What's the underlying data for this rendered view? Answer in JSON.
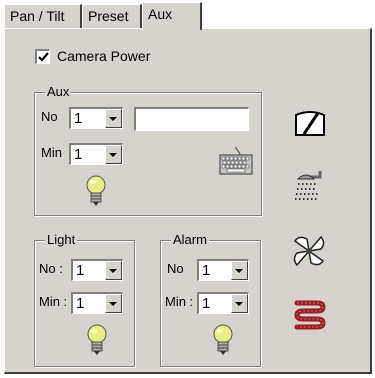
{
  "tabs": [
    {
      "label": "Pan / Tilt"
    },
    {
      "label": "Preset"
    },
    {
      "label": "Aux",
      "active": true
    }
  ],
  "camera_power": {
    "label": "Camera Power",
    "checked": true
  },
  "aux_group": {
    "legend": "Aux",
    "no_label": "No",
    "no_value": "1",
    "min_label": "Min",
    "min_value": "1",
    "text_value": ""
  },
  "light_group": {
    "legend": "Light",
    "no_label": "No :",
    "no_value": "1",
    "min_label": "Min :",
    "min_value": "1"
  },
  "alarm_group": {
    "legend": "Alarm",
    "no_label": "No",
    "no_value": "1",
    "min_label": "Min :",
    "min_value": "1"
  },
  "icons": [
    "wiper-icon",
    "washer-icon",
    "fan-icon",
    "heater-icon",
    "keyboard-icon",
    "lightbulb-icon"
  ],
  "colors": {
    "panel": "#d6d3ce",
    "heater": "#9b1c22",
    "bulb": "#e8ef84"
  }
}
